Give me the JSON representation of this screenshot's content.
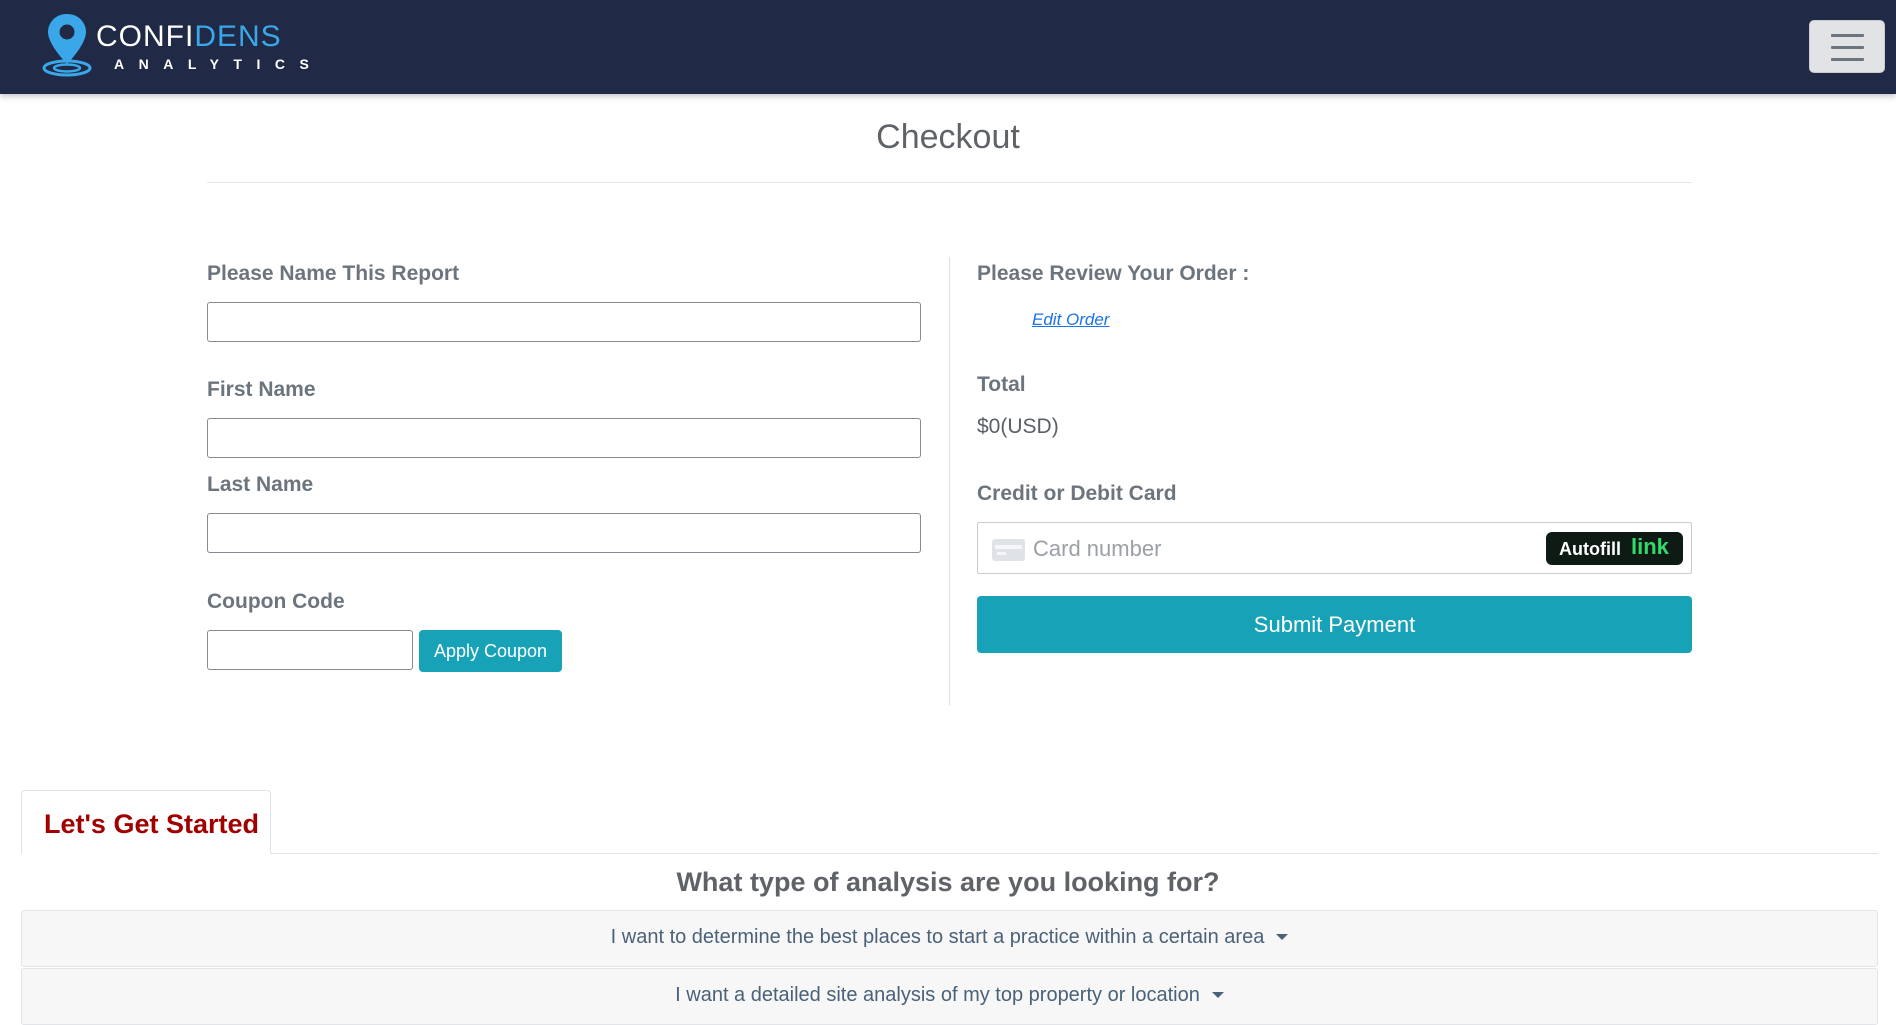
{
  "brand": {
    "name_part1": "CONFI",
    "name_part2": "DENS",
    "tagline": "ANALYTICS",
    "accent_color": "#3aa8e8",
    "nav_background": "#202945"
  },
  "header": {
    "menu_icon": "hamburger-icon"
  },
  "page": {
    "title": "Checkout"
  },
  "form": {
    "report_name_label": "Please Name This Report",
    "report_name_value": "",
    "first_name_label": "First Name",
    "first_name_value": "",
    "last_name_label": "Last Name",
    "last_name_value": "",
    "coupon_label": "Coupon Code",
    "coupon_value": "",
    "apply_coupon_label": "Apply Coupon"
  },
  "order": {
    "review_label": "Please Review Your Order :",
    "edit_link_label": "Edit Order",
    "total_label": "Total",
    "total_value": "$0(USD)",
    "card_label": "Credit or Debit Card",
    "card_placeholder": "Card number",
    "card_icon": "credit-card-icon",
    "autofill_label": "Autofill",
    "autofill_link_label": "link",
    "submit_label": "Submit Payment",
    "button_color": "#17a2b8"
  },
  "tabs": {
    "active_label": "Let's Get Started",
    "active_color": "#a10000"
  },
  "analysis": {
    "question": "What type of analysis are you looking for?",
    "options": [
      {
        "label": "I want to determine the best places to start a practice within a certain area",
        "icon": "caret-down-icon"
      },
      {
        "label": "I want a detailed site analysis of my top property or location",
        "icon": "caret-down-icon"
      }
    ]
  }
}
